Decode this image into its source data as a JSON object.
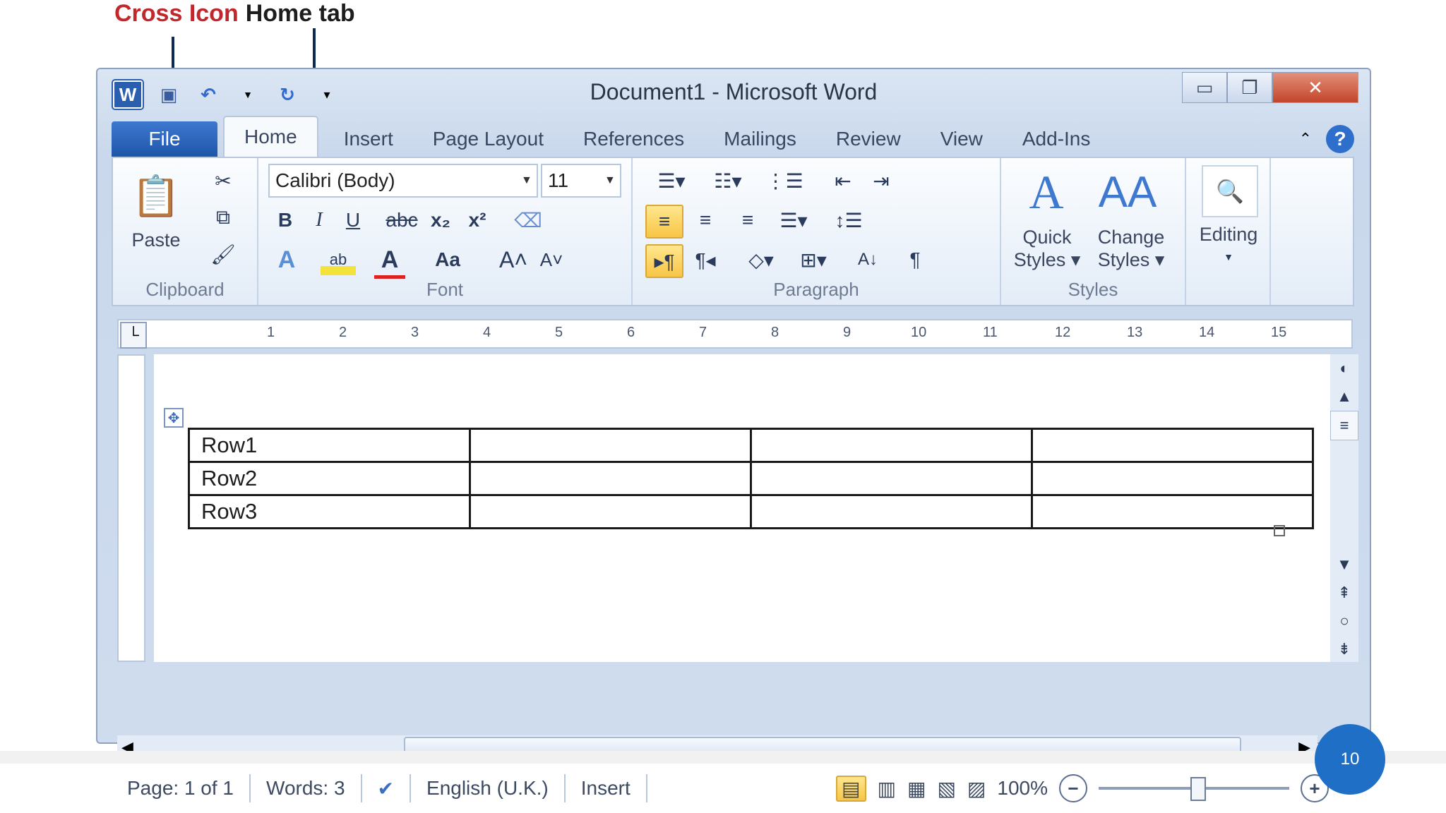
{
  "annotations": {
    "cross_icon": "Cross Icon",
    "home_tab": "Home tab"
  },
  "window": {
    "title": "Document1  -  Microsoft Word",
    "app_icon": "W"
  },
  "tabs": [
    "File",
    "Home",
    "Insert",
    "Page Layout",
    "References",
    "Mailings",
    "Review",
    "View",
    "Add-Ins"
  ],
  "ribbon": {
    "clipboard": {
      "paste": "Paste",
      "label": "Clipboard"
    },
    "font": {
      "name": "Calibri (Body)",
      "size": "11",
      "label": "Font",
      "bold": "B",
      "italic": "I",
      "underline": "U",
      "strike": "abc",
      "sub": "x₂",
      "sup": "x²",
      "grow": "A˄",
      "shrink": "A˅",
      "case": "Aa"
    },
    "paragraph": {
      "label": "Paragraph",
      "pilcrow": "¶"
    },
    "styles": {
      "quick": "Quick",
      "quick2": "Styles",
      "change": "Change",
      "change2": "Styles",
      "label": "Styles"
    },
    "editing": {
      "label": "Editing"
    }
  },
  "ruler": [
    "1",
    "2",
    "3",
    "4",
    "5",
    "6",
    "7",
    "8",
    "9",
    "10",
    "11",
    "12",
    "13",
    "14",
    "15"
  ],
  "table": [
    [
      "Row1",
      "",
      "",
      ""
    ],
    [
      "Row2",
      "",
      "",
      ""
    ],
    [
      "Row3",
      "",
      "",
      ""
    ]
  ],
  "status": {
    "page": "Page: 1 of 1",
    "words": "Words: 3",
    "language": "English (U.K.)",
    "mode": "Insert",
    "zoom": "100%"
  },
  "page_number": "10",
  "colors": {
    "accent": "#2a5fb0",
    "annotation": "#c0282d"
  }
}
